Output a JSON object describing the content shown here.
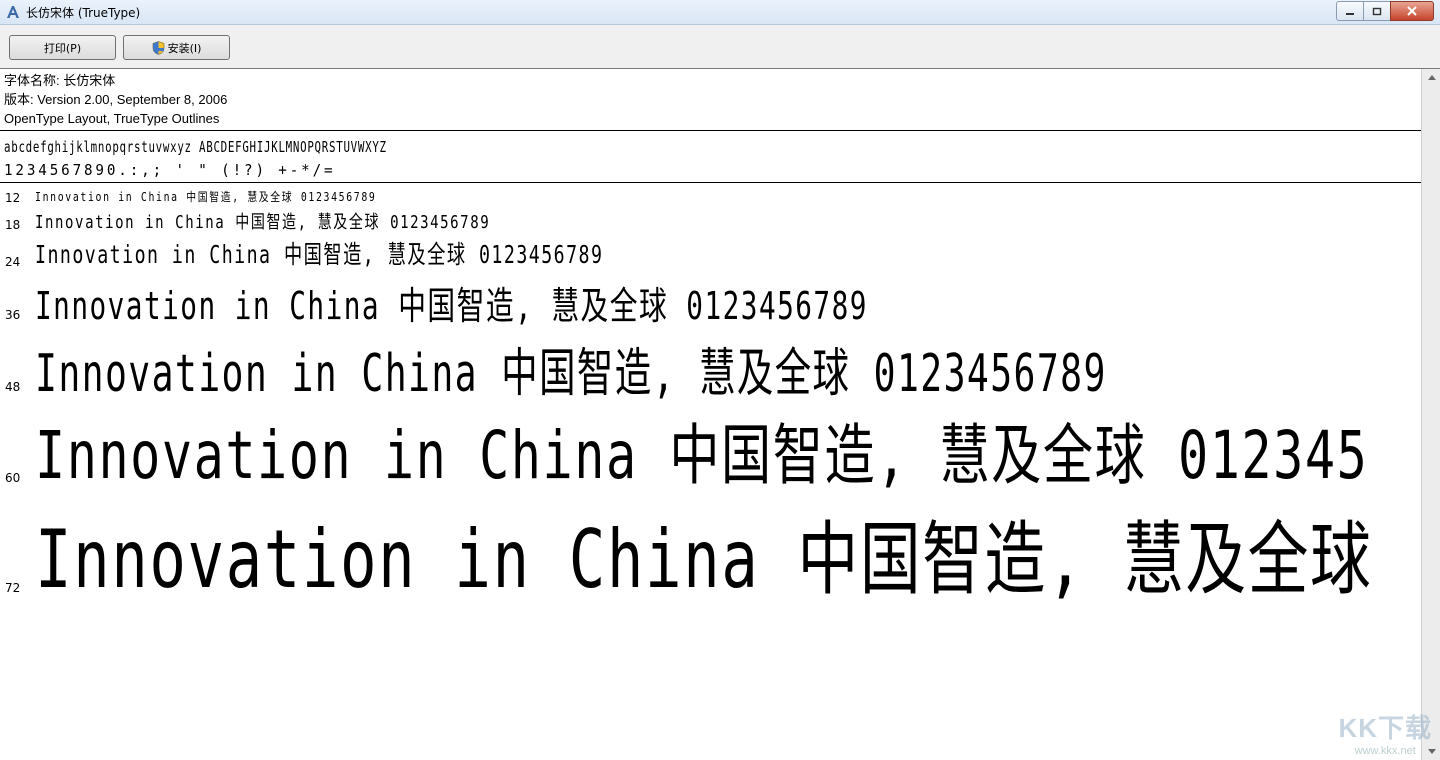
{
  "window": {
    "title": "长仿宋体 (TrueType)",
    "icon": "font-file-icon"
  },
  "toolbar": {
    "print_label": "打印(P)",
    "install_label": "安装(I)",
    "install_icon": "shield-icon"
  },
  "info": {
    "font_name": "字体名称: 长仿宋体",
    "version": "版本: Version 2.00, September 8, 2006",
    "outlines": "OpenType Layout, TrueType Outlines"
  },
  "charset": {
    "line1": "abcdefghijklmnopqrstuvwxyz ABCDEFGHIJKLMNOPQRSTUVWXYZ",
    "line2": "1234567890.:,; ' \" (!?) +-*/="
  },
  "samples": [
    {
      "size": "12",
      "text": "Innovation in China 中国智造, 慧及全球 0123456789"
    },
    {
      "size": "18",
      "text": "Innovation in China 中国智造, 慧及全球 0123456789"
    },
    {
      "size": "24",
      "text": "Innovation in China 中国智造, 慧及全球 0123456789"
    },
    {
      "size": "36",
      "text": "Innovation in China 中国智造, 慧及全球 0123456789"
    },
    {
      "size": "48",
      "text": "Innovation in China 中国智造, 慧及全球 0123456789"
    },
    {
      "size": "60",
      "text": "Innovation in China 中国智造, 慧及全球 012345"
    },
    {
      "size": "72",
      "text": "Innovation in China 中国智造, 慧及全球"
    }
  ],
  "watermark": {
    "logo": "KK下载",
    "url": "www.kkx.net"
  }
}
